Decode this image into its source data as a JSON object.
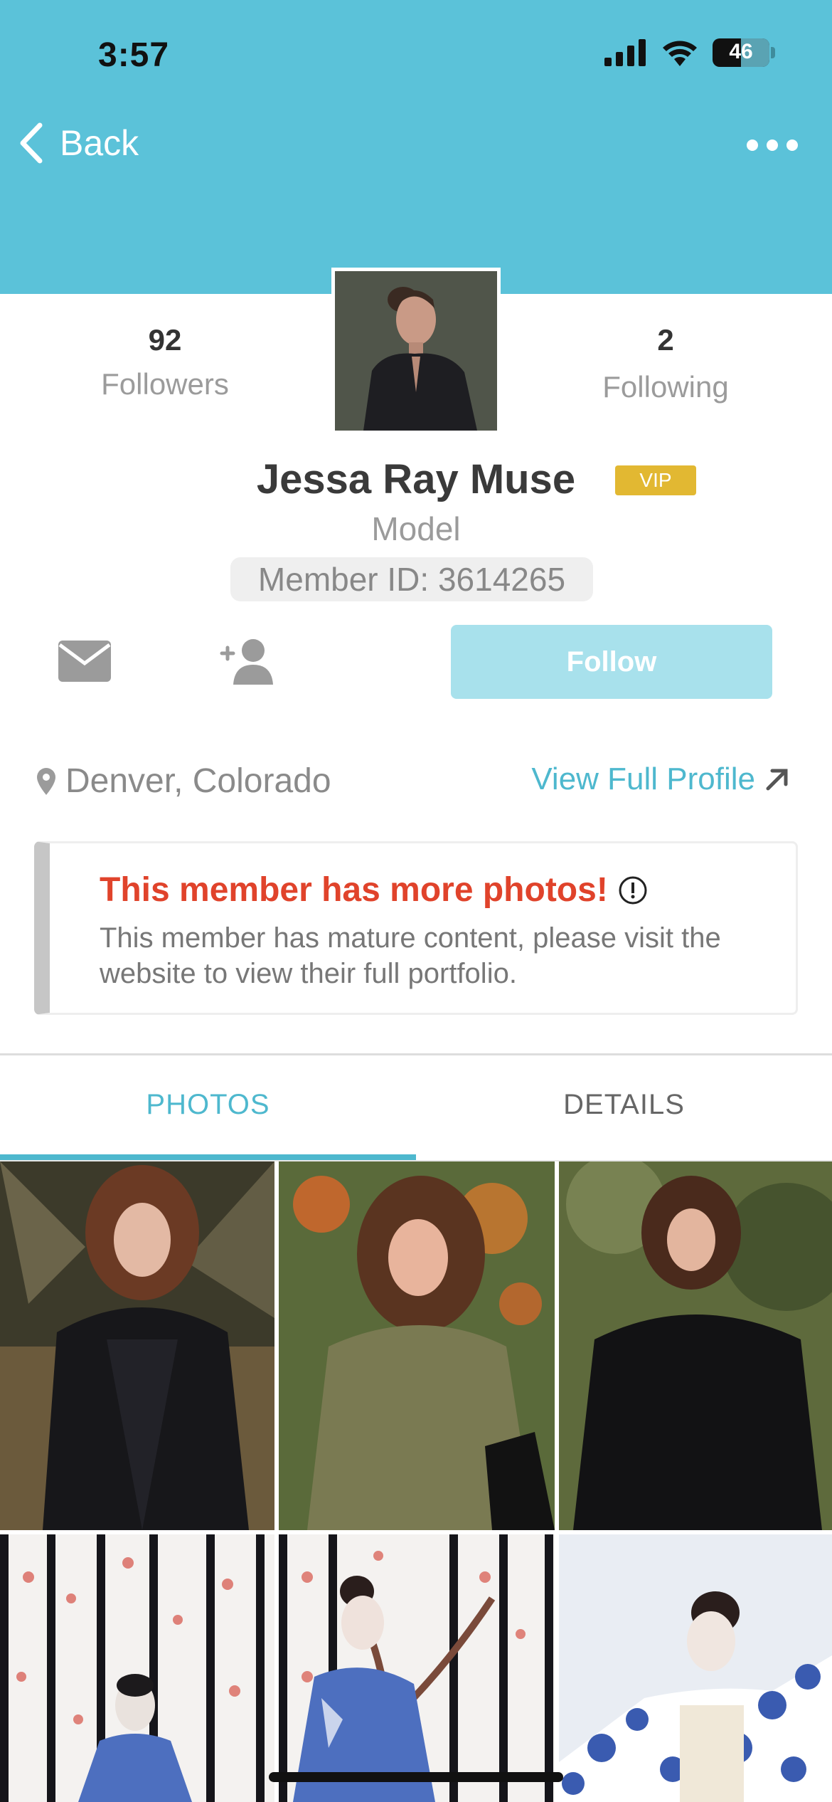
{
  "status_bar": {
    "time": "3:57",
    "battery": "46"
  },
  "nav": {
    "back_label": "Back"
  },
  "profile": {
    "followers_count": "92",
    "followers_label": "Followers",
    "following_count": "2",
    "following_label": "Following",
    "name": "Jessa Ray Muse",
    "badge": "VIP",
    "role": "Model",
    "member_id": "Member ID: 3614265"
  },
  "actions": {
    "follow_label": "Follow"
  },
  "location": "Denver, Colorado",
  "view_full_profile": "View Full Profile",
  "notice": {
    "title": "This member has more photos!",
    "body": "This member has mature content, please visit the website to view their full portfolio."
  },
  "tabs": [
    {
      "label": "PHOTOS",
      "active": true
    },
    {
      "label": "DETAILS",
      "active": false
    }
  ],
  "colors": {
    "header": "#5bc2d9",
    "accent": "#4eb8ce",
    "follow_button": "#a8e1ec",
    "vip_badge": "#e2b832",
    "notice_title": "#e0432b"
  }
}
